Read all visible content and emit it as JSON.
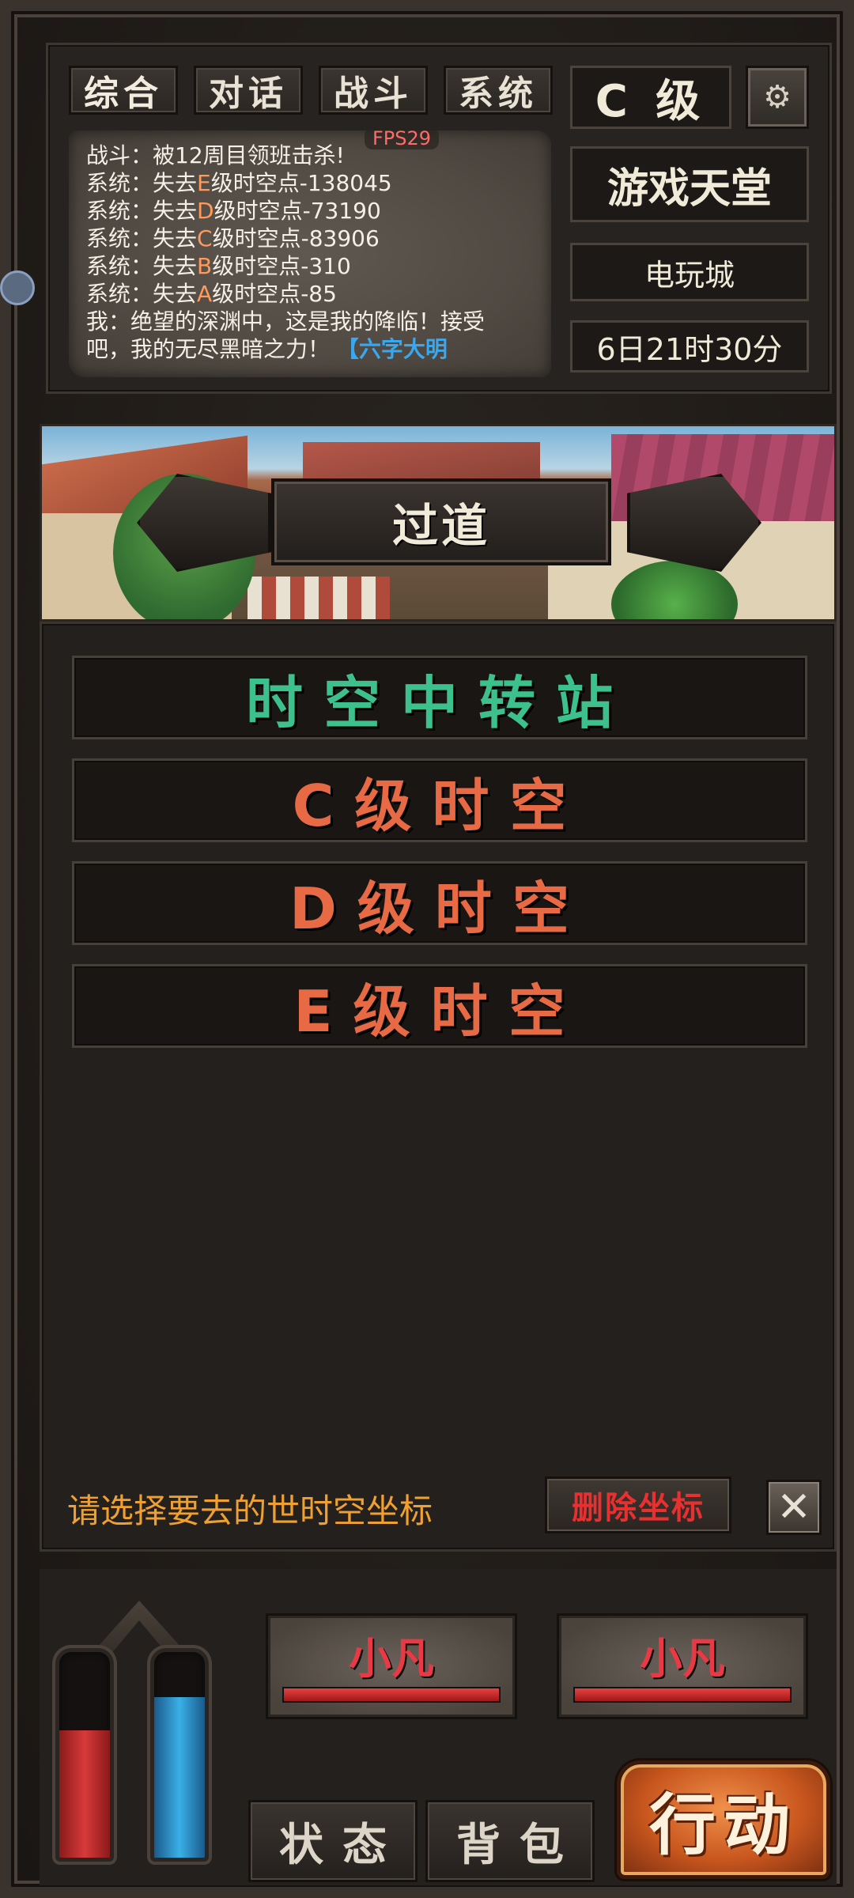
{
  "tabs": [
    "综合",
    "对话",
    "战斗",
    "系统"
  ],
  "fps": "FPS29",
  "log": {
    "line1": "战斗：被12周目领班击杀!",
    "sys_prefix": "系统：失去",
    "sys_suffix": "级时空点",
    "entries": [
      {
        "grade": "E",
        "value": "-138045"
      },
      {
        "grade": "D",
        "value": "-73190"
      },
      {
        "grade": "C",
        "value": "-83906"
      },
      {
        "grade": "B",
        "value": "-310"
      },
      {
        "grade": "A",
        "value": "-85"
      }
    ],
    "chat_line1": "我：绝望的深渊中，这是我的降临！接受",
    "chat_line2": "吧，我的无尽黑暗之力！",
    "chat_highlight": "【六字大明"
  },
  "grade_label": "C 级",
  "settings_icon": "gear-icon",
  "location": "游戏天堂",
  "sub_location": "电玩城",
  "game_time": "6日21时30分",
  "scene": {
    "name": "过道"
  },
  "destinations": [
    {
      "label": "时空中转站",
      "color": "green"
    },
    {
      "label": "C级时空",
      "color": "orange"
    },
    {
      "label": "D级时空",
      "color": "orange"
    },
    {
      "label": "E级时空",
      "color": "orange"
    }
  ],
  "prompt": "请选择要去的世时空坐标",
  "delete_button": "删除坐标",
  "close_icon": "close-icon",
  "hp_fill": 0.62,
  "mp_fill": 0.78,
  "targets": [
    {
      "name": "小凡",
      "hp": 1.0
    },
    {
      "name": "小凡",
      "hp": 1.0
    }
  ],
  "menu": {
    "status": "状态",
    "bag": "背包",
    "action": "行动"
  },
  "colors": {
    "green_text": "#3cc08c",
    "orange_text": "#e86a44",
    "prompt_text": "#f0a030",
    "delete_text": "#e83030",
    "target_name": "#e83a44"
  }
}
